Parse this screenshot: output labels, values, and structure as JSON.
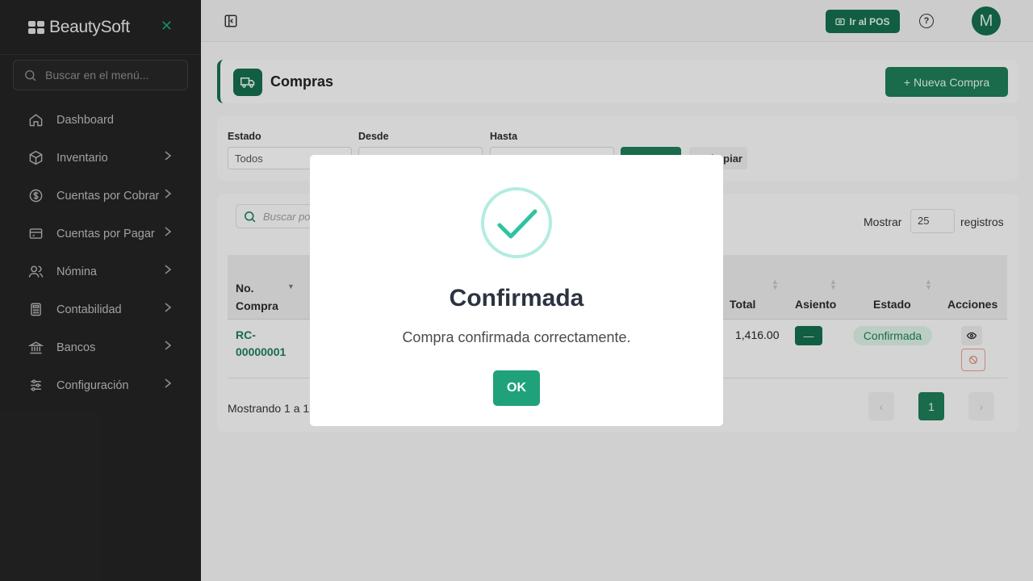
{
  "brand": {
    "name": "BeautySoft",
    "close_icon": "close-icon"
  },
  "sidebar": {
    "search_placeholder": "Buscar en el menú...",
    "items": [
      {
        "label": "Dashboard",
        "icon": "home-icon",
        "has_submenu": false
      },
      {
        "label": "Inventario",
        "icon": "box-icon",
        "has_submenu": true
      },
      {
        "label": "Cuentas por Cobrar",
        "icon": "dollar-circle-icon",
        "has_submenu": true
      },
      {
        "label": "Cuentas por Pagar",
        "icon": "credit-card-icon",
        "has_submenu": true
      },
      {
        "label": "Nómina",
        "icon": "users-icon",
        "has_submenu": true
      },
      {
        "label": "Contabilidad",
        "icon": "calculator-icon",
        "has_submenu": true
      },
      {
        "label": "Bancos",
        "icon": "bank-icon",
        "has_submenu": true
      },
      {
        "label": "Configuración",
        "icon": "sliders-icon",
        "has_submenu": true
      }
    ]
  },
  "topbar": {
    "pos_button": "Ir al POS",
    "help": "?",
    "avatar_initial": "M"
  },
  "page": {
    "title": "Compras",
    "new_button": "+ Nueva Compra"
  },
  "filters": {
    "estado_label": "Estado",
    "estado_value": "Todos",
    "desde_label": "Desde",
    "hasta_label": "Hasta",
    "limpiar_label": "Limpiar"
  },
  "table": {
    "search_placeholder": "Buscar po",
    "show_label": "Mostrar",
    "page_size": "25",
    "records_label": "registros",
    "headers": {
      "no_compra_1": "No.",
      "no_compra_2": "Compra",
      "total": "Total",
      "asiento": "Asiento",
      "estado": "Estado",
      "acciones": "Acciones"
    },
    "rows": [
      {
        "no_compra_1": "RC-",
        "no_compra_2": "00000001",
        "total": "1,416.00",
        "asiento": "—",
        "estado": "Confirmada"
      }
    ],
    "showing": "Mostrando 1 a 1",
    "pagination": {
      "prev": "‹",
      "current": "1",
      "next": "›"
    }
  },
  "modal": {
    "icon": "check-icon",
    "title": "Confirmada",
    "text": "Compra confirmada correctamente.",
    "ok": "OK"
  },
  "colors": {
    "primary": "#156c4c",
    "success_check": "#2ec4a0",
    "ok_button": "#1fa27a",
    "sidebar_bg": "#232323"
  }
}
